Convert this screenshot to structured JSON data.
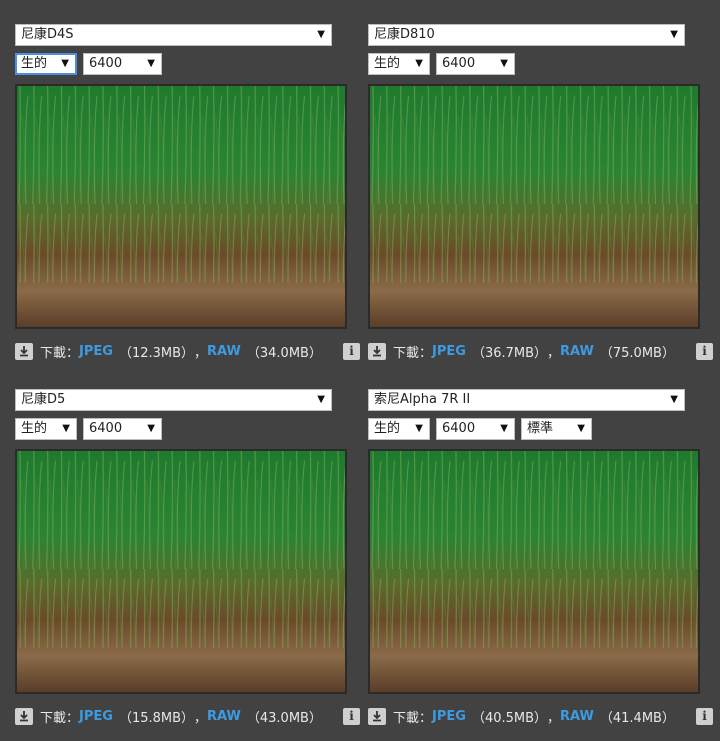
{
  "panels": [
    {
      "camera": "尼康D4S",
      "mode": "生的",
      "iso": "6400",
      "extra": null,
      "download_label": "下載：",
      "jpeg_label": "JPEG",
      "jpeg_size": "（12.3MB）",
      "separator": "，",
      "raw_label": "RAW",
      "raw_size": "（34.0MB）"
    },
    {
      "camera": "尼康D810",
      "mode": "生的",
      "iso": "6400",
      "extra": null,
      "download_label": "下載：",
      "jpeg_label": "JPEG",
      "jpeg_size": "（36.7MB）",
      "separator": "，",
      "raw_label": "RAW",
      "raw_size": "（75.0MB）"
    },
    {
      "camera": "尼康D5",
      "mode": "生的",
      "iso": "6400",
      "extra": null,
      "download_label": "下載：",
      "jpeg_label": "JPEG",
      "jpeg_size": "（15.8MB）",
      "separator": "，",
      "raw_label": "RAW",
      "raw_size": "（43.0MB）"
    },
    {
      "camera": "索尼Alpha 7R II",
      "mode": "生的",
      "iso": "6400",
      "extra": "標準",
      "download_label": "下載：",
      "jpeg_label": "JPEG",
      "jpeg_size": "（40.5MB）",
      "separator": "，",
      "raw_label": "RAW",
      "raw_size": "（41.4MB）"
    }
  ],
  "icons": {
    "dropdown": "▼",
    "info": "i"
  },
  "colors": {
    "background": "#424242",
    "link": "#3d9be0",
    "focus": "#4a90e2"
  }
}
